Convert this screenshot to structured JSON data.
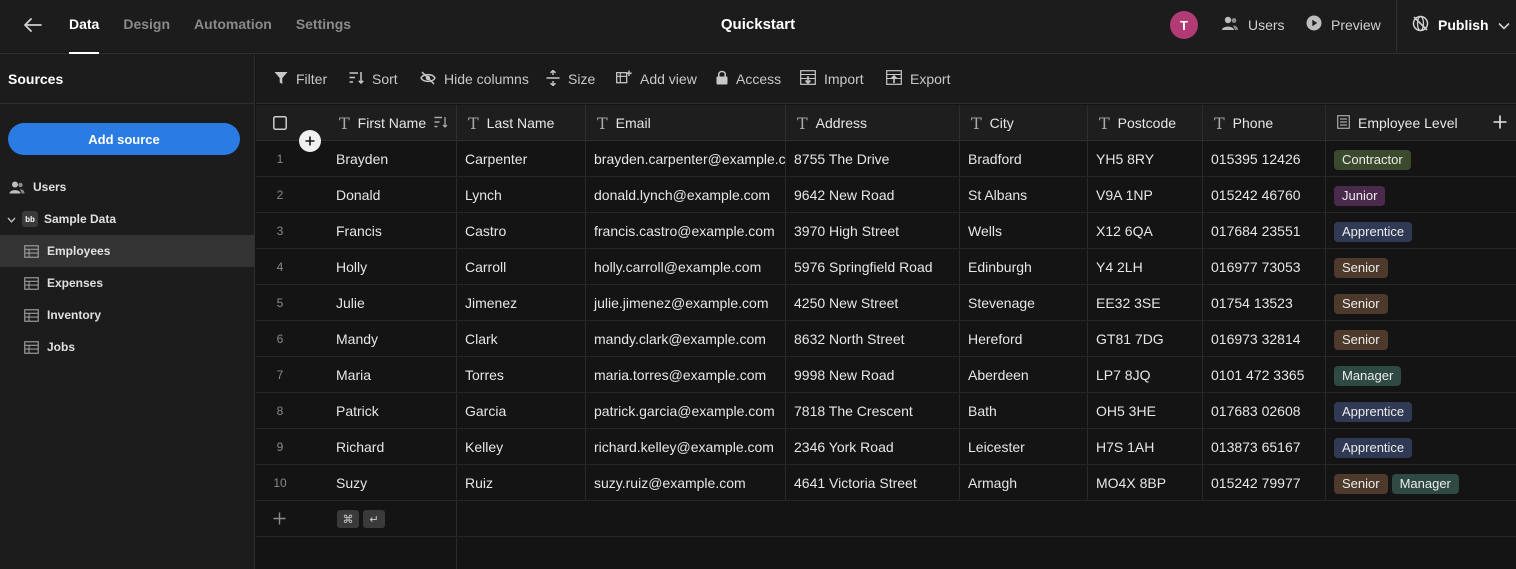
{
  "topbar": {
    "tabs": [
      {
        "label": "Data",
        "active": true
      },
      {
        "label": "Design",
        "active": false
      },
      {
        "label": "Automation",
        "active": false
      },
      {
        "label": "Settings",
        "active": false
      }
    ],
    "app_title": "Quickstart",
    "avatar_initial": "T",
    "users_label": "Users",
    "preview_label": "Preview",
    "publish_label": "Publish"
  },
  "sidebar": {
    "title": "Sources",
    "add_source_label": "Add source",
    "items": [
      {
        "label": "Users",
        "icon": "users-icon"
      },
      {
        "label": "Sample Data",
        "icon": "budibase-logo-icon",
        "logo_text": "bb"
      },
      {
        "label": "Employees",
        "icon": "table-icon",
        "selected": true
      },
      {
        "label": "Expenses",
        "icon": "table-icon"
      },
      {
        "label": "Inventory",
        "icon": "table-icon"
      },
      {
        "label": "Jobs",
        "icon": "table-icon"
      }
    ]
  },
  "toolbar": {
    "filter": "Filter",
    "sort": "Sort",
    "hide_columns": "Hide columns",
    "size": "Size",
    "add_view": "Add view",
    "access": "Access",
    "import": "Import",
    "export": "Export"
  },
  "table": {
    "columns": [
      "First Name",
      "Last Name",
      "Email",
      "Address",
      "City",
      "Postcode",
      "Phone",
      "Employee Level"
    ],
    "rows": [
      {
        "num": "1",
        "first": "Brayden",
        "last": "Carpenter",
        "email": "brayden.carpenter@example.com",
        "address": "8755 The Drive",
        "city": "Bradford",
        "postcode": "YH5 8RY",
        "phone": "015395 12426",
        "levels": [
          "Contractor"
        ]
      },
      {
        "num": "2",
        "first": "Donald",
        "last": "Lynch",
        "email": "donald.lynch@example.com",
        "address": "9642 New Road",
        "city": "St Albans",
        "postcode": "V9A 1NP",
        "phone": "015242 46760",
        "levels": [
          "Junior"
        ]
      },
      {
        "num": "3",
        "first": "Francis",
        "last": "Castro",
        "email": "francis.castro@example.com",
        "address": "3970 High Street",
        "city": "Wells",
        "postcode": "X12 6QA",
        "phone": "017684 23551",
        "levels": [
          "Apprentice"
        ]
      },
      {
        "num": "4",
        "first": "Holly",
        "last": "Carroll",
        "email": "holly.carroll@example.com",
        "address": "5976 Springfield Road",
        "city": "Edinburgh",
        "postcode": "Y4 2LH",
        "phone": "016977 73053",
        "levels": [
          "Senior"
        ]
      },
      {
        "num": "5",
        "first": "Julie",
        "last": "Jimenez",
        "email": "julie.jimenez@example.com",
        "address": "4250 New Street",
        "city": "Stevenage",
        "postcode": "EE32 3SE",
        "phone": "01754 13523",
        "levels": [
          "Senior"
        ]
      },
      {
        "num": "6",
        "first": "Mandy",
        "last": "Clark",
        "email": "mandy.clark@example.com",
        "address": "8632 North Street",
        "city": "Hereford",
        "postcode": "GT81 7DG",
        "phone": "016973 32814",
        "levels": [
          "Senior"
        ]
      },
      {
        "num": "7",
        "first": "Maria",
        "last": "Torres",
        "email": "maria.torres@example.com",
        "address": "9998 New Road",
        "city": "Aberdeen",
        "postcode": "LP7 8JQ",
        "phone": "0101 472 3365",
        "levels": [
          "Manager"
        ]
      },
      {
        "num": "8",
        "first": "Patrick",
        "last": "Garcia",
        "email": "patrick.garcia@example.com",
        "address": "7818 The Crescent",
        "city": "Bath",
        "postcode": "OH5 3HE",
        "phone": "017683 02608",
        "levels": [
          "Apprentice"
        ]
      },
      {
        "num": "9",
        "first": "Richard",
        "last": "Kelley",
        "email": "richard.kelley@example.com",
        "address": "2346 York Road",
        "city": "Leicester",
        "postcode": "H7S 1AH",
        "phone": "013873 65167",
        "levels": [
          "Apprentice"
        ]
      },
      {
        "num": "10",
        "first": "Suzy",
        "last": "Ruiz",
        "email": "suzy.ruiz@example.com",
        "address": "4641 Victoria Street",
        "city": "Armagh",
        "postcode": "MO4X 8BP",
        "phone": "015242 79977",
        "levels": [
          "Senior",
          "Manager"
        ]
      }
    ],
    "level_colors": {
      "Contractor": "#3b4a2c",
      "Junior": "#4a2a4d",
      "Apprentice": "#303a55",
      "Senior": "#4d3a2c",
      "Manager": "#2e4a42"
    },
    "shortcut_keys": [
      "⌘",
      "↵"
    ]
  }
}
